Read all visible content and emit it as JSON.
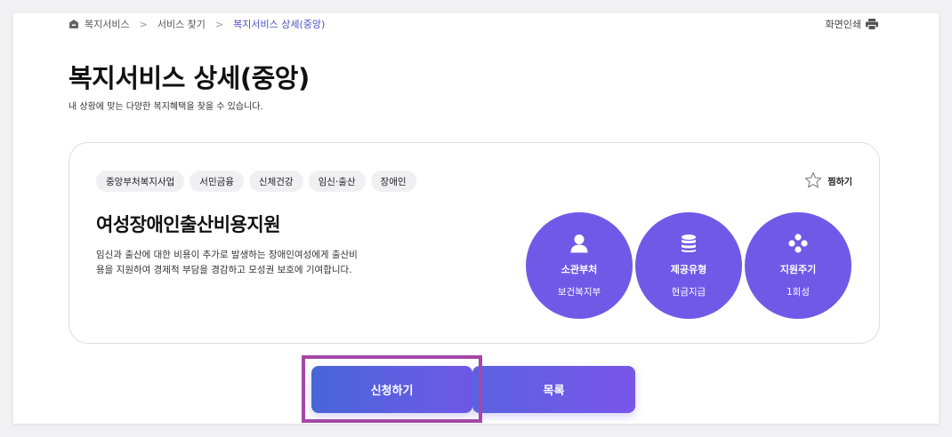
{
  "breadcrumb": {
    "items": [
      "복지서비스",
      "서비스 찾기",
      "복지서비스 상세(중앙)"
    ],
    "separator": ">"
  },
  "print": {
    "label": "화면인쇄",
    "icon": "printer-icon"
  },
  "page": {
    "title": "복지서비스 상세(중앙)",
    "description": "내 상황에 맞는 다양한 복지혜택을 찾을 수 있습니다."
  },
  "card": {
    "tags": [
      "중앙부처복지사업",
      "서민금융",
      "신체건강",
      "임신·출산",
      "장애인"
    ],
    "bookmark": {
      "label": "찜하기",
      "icon": "star-icon"
    },
    "service_name": "여성장애인출산비용지원",
    "service_desc": "임신과 출산에 대한 비용이 추가로 발생하는 장애인여성에게 출산비용을 지원하여 경제적 부담을 경감하고 모성권 보호에 기여합니다.",
    "info": [
      {
        "label": "소관부처",
        "value": "보건복지부",
        "icon": "person-icon"
      },
      {
        "label": "제공유형",
        "value": "현금지급",
        "icon": "coins-icon"
      },
      {
        "label": "지원주기",
        "value": "1회성",
        "icon": "dots-icon"
      }
    ]
  },
  "buttons": {
    "apply": "신청하기",
    "list": "목록"
  },
  "colors": {
    "accent": "#7159e8",
    "highlight": "#a447a8",
    "current_crumb": "#4b4fc4"
  }
}
